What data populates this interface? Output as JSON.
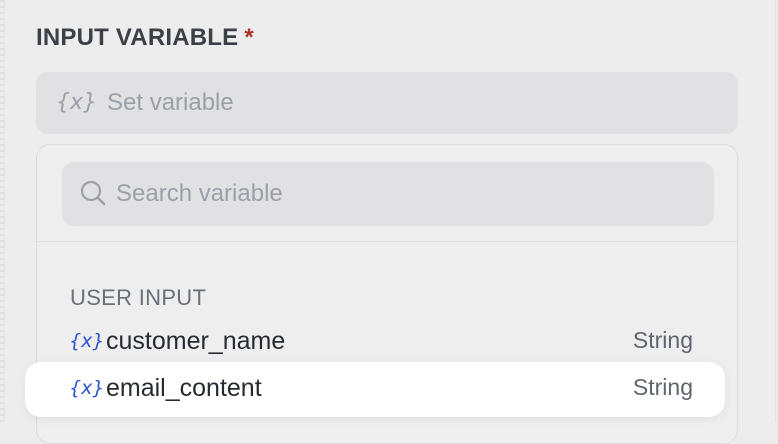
{
  "field": {
    "label": "INPUT VARIABLE",
    "required_mark": "*"
  },
  "set_variable": {
    "icon": "{x}",
    "text": "Set variable"
  },
  "dropdown": {
    "search": {
      "placeholder": "Search variable",
      "value": ""
    },
    "group_header": "USER INPUT",
    "items": [
      {
        "icon": "{x}",
        "name": "customer_name",
        "type": "String",
        "selected": false
      },
      {
        "icon": "{x}",
        "name": "email_content",
        "type": "String",
        "selected": true
      }
    ]
  },
  "colors": {
    "accent": "#2f55d4",
    "required": "#b0302c",
    "overlay": "#ededed",
    "highlight": "#ffffff"
  }
}
